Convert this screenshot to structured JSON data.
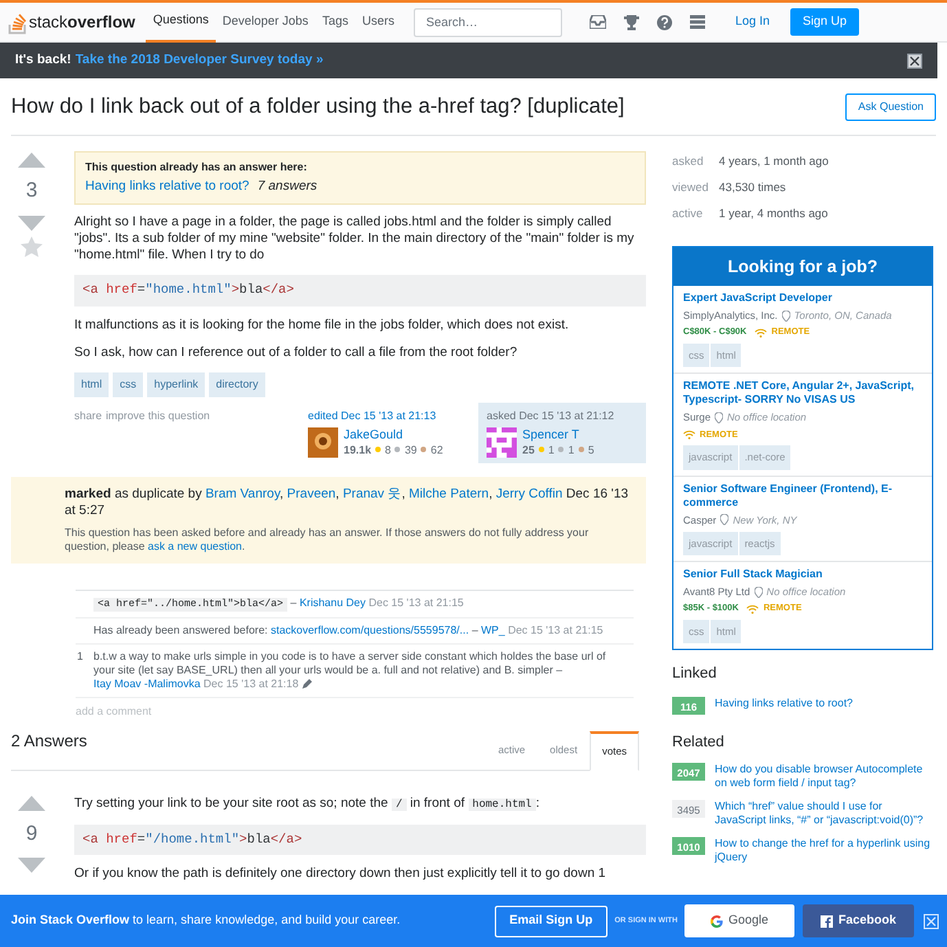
{
  "nav": {
    "logo": "stack**overflow**",
    "items": [
      {
        "label": "Questions",
        "selected": true
      },
      {
        "label": "Developer Jobs",
        "selected": false
      },
      {
        "label": "Tags",
        "selected": false
      },
      {
        "label": "Users",
        "selected": false
      }
    ],
    "search": {
      "placeholder": "Search…"
    },
    "login": "Log In",
    "signup": "Sign Up"
  },
  "announcement": {
    "lead": "It's back!",
    "link": "Take the 2018 Developer Survey today »"
  },
  "question": {
    "title": "How do I link back out of a folder using the a-href tag? [duplicate]",
    "ask_button": "Ask Question",
    "votes": "3",
    "duplicate_notice": {
      "heading": "This question already has an answer here:",
      "link": "Having links relative to root?",
      "answers": "7 answers"
    },
    "body": [
      {
        "kind": "p",
        "text": "Alright so I have a page in a folder, the page is called jobs.html and the folder is simply called \"jobs\". Its a sub folder of my mine \"website\" folder. In the main directory of the \"main\" folder is my \"home.html\" file. When I try to do"
      },
      {
        "kind": "code",
        "tokens": [
          {
            "t": "<a ",
            "kind": "tag"
          },
          {
            "t": "href",
            "kind": "attr"
          },
          {
            "t": "=",
            "kind": "plain"
          },
          {
            "t": "\"home.html\"",
            "kind": "str"
          },
          {
            "t": ">",
            "kind": "tag"
          },
          {
            "t": "bla",
            "kind": "plain"
          },
          {
            "t": "</a>",
            "kind": "tag"
          }
        ]
      },
      {
        "kind": "p",
        "text": "It malfunctions as it is looking for the home file in the jobs folder, which does not exist."
      },
      {
        "kind": "p",
        "text": "So I ask, how can I reference out of a folder to call a file from the root folder?"
      }
    ],
    "tags": [
      "html",
      "css",
      "hyperlink",
      "directory"
    ],
    "actions": [
      "share",
      "improve this question"
    ],
    "editor": {
      "action": "edited Dec 15 '13 at 21:13",
      "name": "JakeGould",
      "rep": "19.1k",
      "gold": "8",
      "silver": "39",
      "bronze": "62"
    },
    "owner": {
      "action": "asked Dec 15 '13 at 21:12",
      "name": "Spencer T",
      "rep": "25",
      "gold": "1",
      "silver": "1",
      "bronze": "5"
    },
    "marked": {
      "text": "**marked** as duplicate by",
      "separator": ",",
      "users": [
        "Bram Vanroy",
        "Praveen",
        "Pranav 웃",
        "Milche Patern",
        "Jerry Coffin"
      ],
      "date": "Dec 16 '13 at 5:27",
      "note": "This question has been asked before and already has an answer. If those answers do not fully address your question, please",
      "note_link": "ask a new question",
      "note_end": "."
    },
    "comments": [
      {
        "code": "<a href=\"../home.html\">bla</a>",
        "dash": "–",
        "user": "Krishanu Dey",
        "date": "Dec 15 '13 at 21:15",
        "edited": false
      },
      {
        "text": "Has already been answered before:",
        "link": "stackoverflow.com/questions/5559578/...",
        "dash": "–",
        "user": "WP_",
        "date": "Dec 15 '13 at 21:15",
        "edited": false
      },
      {
        "score": "1",
        "text": "b.t.w a way to make urls simple in you code is to have a server side constant which holdes the base url of your site (let say BASE_URL) then all your urls would be a. full and not relative) and B. simpler",
        "dash": "–",
        "user": "Itay Moav -Malimovka",
        "date": "Dec 15 '13 at 21:18",
        "edited": true
      }
    ],
    "add_comment": "add a comment"
  },
  "answers": {
    "heading": "2 Answers",
    "tabs": [
      {
        "label": "active",
        "selected": false
      },
      {
        "label": "oldest",
        "selected": false
      },
      {
        "label": "votes",
        "selected": true
      }
    ],
    "first": {
      "votes": "9",
      "intro": [
        {
          "t": "Try setting your link to be your site root as so; note the ",
          "kind": "text"
        },
        {
          "t": "/",
          "kind": "code"
        },
        {
          "t": " in front of ",
          "kind": "text"
        },
        {
          "t": "home.html",
          "kind": "code"
        },
        {
          "t": ":",
          "kind": "text"
        }
      ],
      "code": [
        {
          "t": "<a ",
          "kind": "tag"
        },
        {
          "t": "href",
          "kind": "attr"
        },
        {
          "t": "=",
          "kind": "plain"
        },
        {
          "t": "\"/home.html\"",
          "kind": "str"
        },
        {
          "t": ">",
          "kind": "tag"
        },
        {
          "t": "bla",
          "kind": "plain"
        },
        {
          "t": "</a>",
          "kind": "tag"
        }
      ],
      "next": "Or if you know the path is definitely one directory down then just explicitly tell it to go down 1"
    }
  },
  "sidebar": {
    "stats": [
      {
        "label": "asked",
        "value": "4 years, 1 month ago"
      },
      {
        "label": "viewed",
        "value": "43,530 times"
      },
      {
        "label": "active",
        "value": "1 year, 4 months ago"
      }
    ],
    "jobs": {
      "title": "Looking for a job?",
      "items": [
        {
          "title": "Expert JavaScript Developer",
          "company": "SimplyAnalytics, Inc.",
          "location": "Toronto, ON, Canada",
          "salary": "C$80K - C$90K",
          "remote": true,
          "remote_label": "REMOTE",
          "tags": [
            "css",
            "html"
          ]
        },
        {
          "title": "REMOTE .NET Core, Angular 2+, JavaScript, Typescript- SORRY No VISAS US",
          "company": "Surge",
          "location": "No office location",
          "remote": true,
          "remote_label": "REMOTE",
          "tags": [
            "javascript",
            ".net-core"
          ]
        },
        {
          "title": "Senior Software Engineer (Frontend), E-commerce",
          "company": "Casper",
          "location": "New York, NY",
          "remote": false,
          "tags": [
            "javascript",
            "reactjs"
          ]
        },
        {
          "title": "Senior Full Stack Magician",
          "company": "Avant8 Pty Ltd",
          "location": "No office location",
          "salary": "$85K - $100K",
          "remote": true,
          "remote_label": "REMOTE",
          "tags": [
            "css",
            "html"
          ]
        }
      ]
    },
    "linked": {
      "heading": "Linked",
      "items": [
        {
          "count": "116",
          "answered": true,
          "title": "Having links relative to root?"
        }
      ]
    },
    "related": {
      "heading": "Related",
      "items": [
        {
          "count": "2047",
          "answered": true,
          "title": "How do you disable browser Autocomplete on web form field / input tag?"
        },
        {
          "count": "3495",
          "answered": false,
          "title": "Which “href” value should I use for JavaScript links, “#” or “javascript:void(0)”?"
        },
        {
          "count": "1010",
          "answered": true,
          "title": "How to change the href for a hyperlink using jQuery"
        }
      ]
    }
  },
  "banner": {
    "text": "**Join Stack Overflow** to learn, share knowledge, and build your career.",
    "email_button": "Email Sign Up",
    "or_text": "OR SIGN IN WITH",
    "google": "Google",
    "facebook": "Facebook"
  }
}
